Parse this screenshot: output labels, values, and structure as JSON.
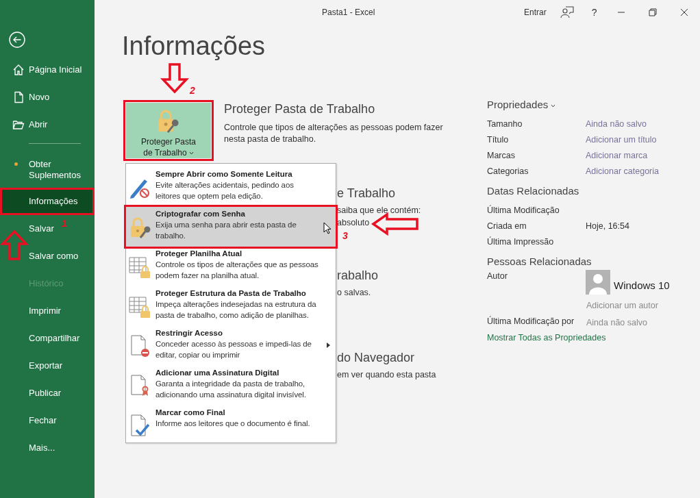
{
  "window": {
    "title": "Pasta1  -  Excel",
    "sign_in": "Entrar",
    "help": "?"
  },
  "sidebar": {
    "top_items": [
      {
        "label": "Página Inicial",
        "selected": false,
        "disabled": false,
        "notify": false,
        "highlighted": false
      },
      {
        "label": "Novo",
        "selected": false,
        "disabled": false,
        "notify": false,
        "highlighted": false
      },
      {
        "label": "Abrir",
        "selected": false,
        "disabled": false,
        "notify": false,
        "highlighted": false
      }
    ],
    "items": [
      {
        "label": "Obter Suplementos",
        "selected": false,
        "disabled": false,
        "notify": true,
        "highlighted": false
      },
      {
        "label": "Informações",
        "selected": true,
        "disabled": false,
        "notify": false,
        "highlighted": true
      },
      {
        "label": "Salvar",
        "selected": false,
        "disabled": false,
        "notify": false,
        "highlighted": false
      },
      {
        "label": "Salvar como",
        "selected": false,
        "disabled": false,
        "notify": false,
        "highlighted": false
      },
      {
        "label": "Histórico",
        "selected": false,
        "disabled": true,
        "notify": false,
        "highlighted": false
      },
      {
        "label": "Imprimir",
        "selected": false,
        "disabled": false,
        "notify": false,
        "highlighted": false
      },
      {
        "label": "Compartilhar",
        "selected": false,
        "disabled": false,
        "notify": false,
        "highlighted": false
      },
      {
        "label": "Exportar",
        "selected": false,
        "disabled": false,
        "notify": false,
        "highlighted": false
      },
      {
        "label": "Publicar",
        "selected": false,
        "disabled": false,
        "notify": false,
        "highlighted": false
      },
      {
        "label": "Fechar",
        "selected": false,
        "disabled": false,
        "notify": false,
        "highlighted": false
      },
      {
        "label": "Mais...",
        "selected": false,
        "disabled": false,
        "notify": false,
        "highlighted": false
      }
    ]
  },
  "page": {
    "heading": "Informações"
  },
  "protect": {
    "button": {
      "label": "Proteger Pasta de Trabalho",
      "highlighted": true
    },
    "title": "Proteger Pasta de Trabalho",
    "description": "Controle que tipos de alterações as pessoas podem fazer nesta pasta de trabalho."
  },
  "hidden_sections": [
    {
      "heading": "e Trabalho",
      "lines": [
        "saiba que ele contém:",
        "absoluto"
      ]
    },
    {
      "heading": "rabalho",
      "lines": [
        "o salvas."
      ]
    },
    {
      "heading": "do Navegador",
      "lines": [
        "em ver quando esta pasta"
      ]
    }
  ],
  "protect_menu": {
    "items": [
      {
        "title": "Sempre Abrir como Somente Leitura",
        "description": "Evite alterações acidentais, pedindo aos leitores que optem pela edição.",
        "selected": false,
        "highlighted": false,
        "submenu": false
      },
      {
        "title": "Criptografar com Senha",
        "description": "Exija uma senha para abrir esta pasta de trabalho.",
        "selected": true,
        "highlighted": true,
        "submenu": false
      },
      {
        "title": "Proteger Planilha Atual",
        "description": "Controle os tipos de alterações que as pessoas podem fazer na planilha atual.",
        "selected": false,
        "highlighted": false,
        "submenu": false
      },
      {
        "title": "Proteger Estrutura da Pasta de Trabalho",
        "description": "Impeça alterações indesejadas na estrutura da pasta de trabalho, como adição de planilhas.",
        "selected": false,
        "highlighted": false,
        "submenu": false
      },
      {
        "title": "Restringir Acesso",
        "description": "Conceder acesso às pessoas e impedi-las de editar, copiar ou imprimir",
        "selected": false,
        "highlighted": false,
        "submenu": true
      },
      {
        "title": "Adicionar uma Assinatura Digital",
        "description": "Garanta a integridade da pasta de trabalho, adicionando uma assinatura digital invisível.",
        "selected": false,
        "highlighted": false,
        "submenu": false
      },
      {
        "title": "Marcar como Final",
        "description": "Informe aos leitores que o documento é final.",
        "selected": false,
        "highlighted": false,
        "submenu": false
      }
    ]
  },
  "properties": {
    "heading": "Propriedades",
    "rows": [
      {
        "label": "Tamanho",
        "value": "Ainda não salvo",
        "kind": "hint"
      },
      {
        "label": "Título",
        "value": "Adicionar um título",
        "kind": "hint"
      },
      {
        "label": "Marcas",
        "value": "Adicionar marca",
        "kind": "hint"
      },
      {
        "label": "Categorias",
        "value": "Adicionar categoria",
        "kind": "hint"
      }
    ]
  },
  "related_dates": {
    "heading": "Datas Relacionadas",
    "rows": [
      {
        "label": "Última Modificação"
      },
      {
        "label": "Criada em",
        "value": "Hoje, 16:54"
      },
      {
        "label": "Última Impressão"
      }
    ]
  },
  "related_people": {
    "heading": "Pessoas Relacionadas",
    "author": {
      "label": "Autor",
      "name": "Windows 10",
      "add": "Adicionar um autor"
    },
    "last_modified_by": {
      "label": "Última Modificação por",
      "value": "Ainda não salvo"
    }
  },
  "show_all_link": "Mostrar Todas as Propriedades",
  "callouts": [
    {
      "number": "1"
    },
    {
      "number": "2"
    },
    {
      "number": "3"
    }
  ]
}
